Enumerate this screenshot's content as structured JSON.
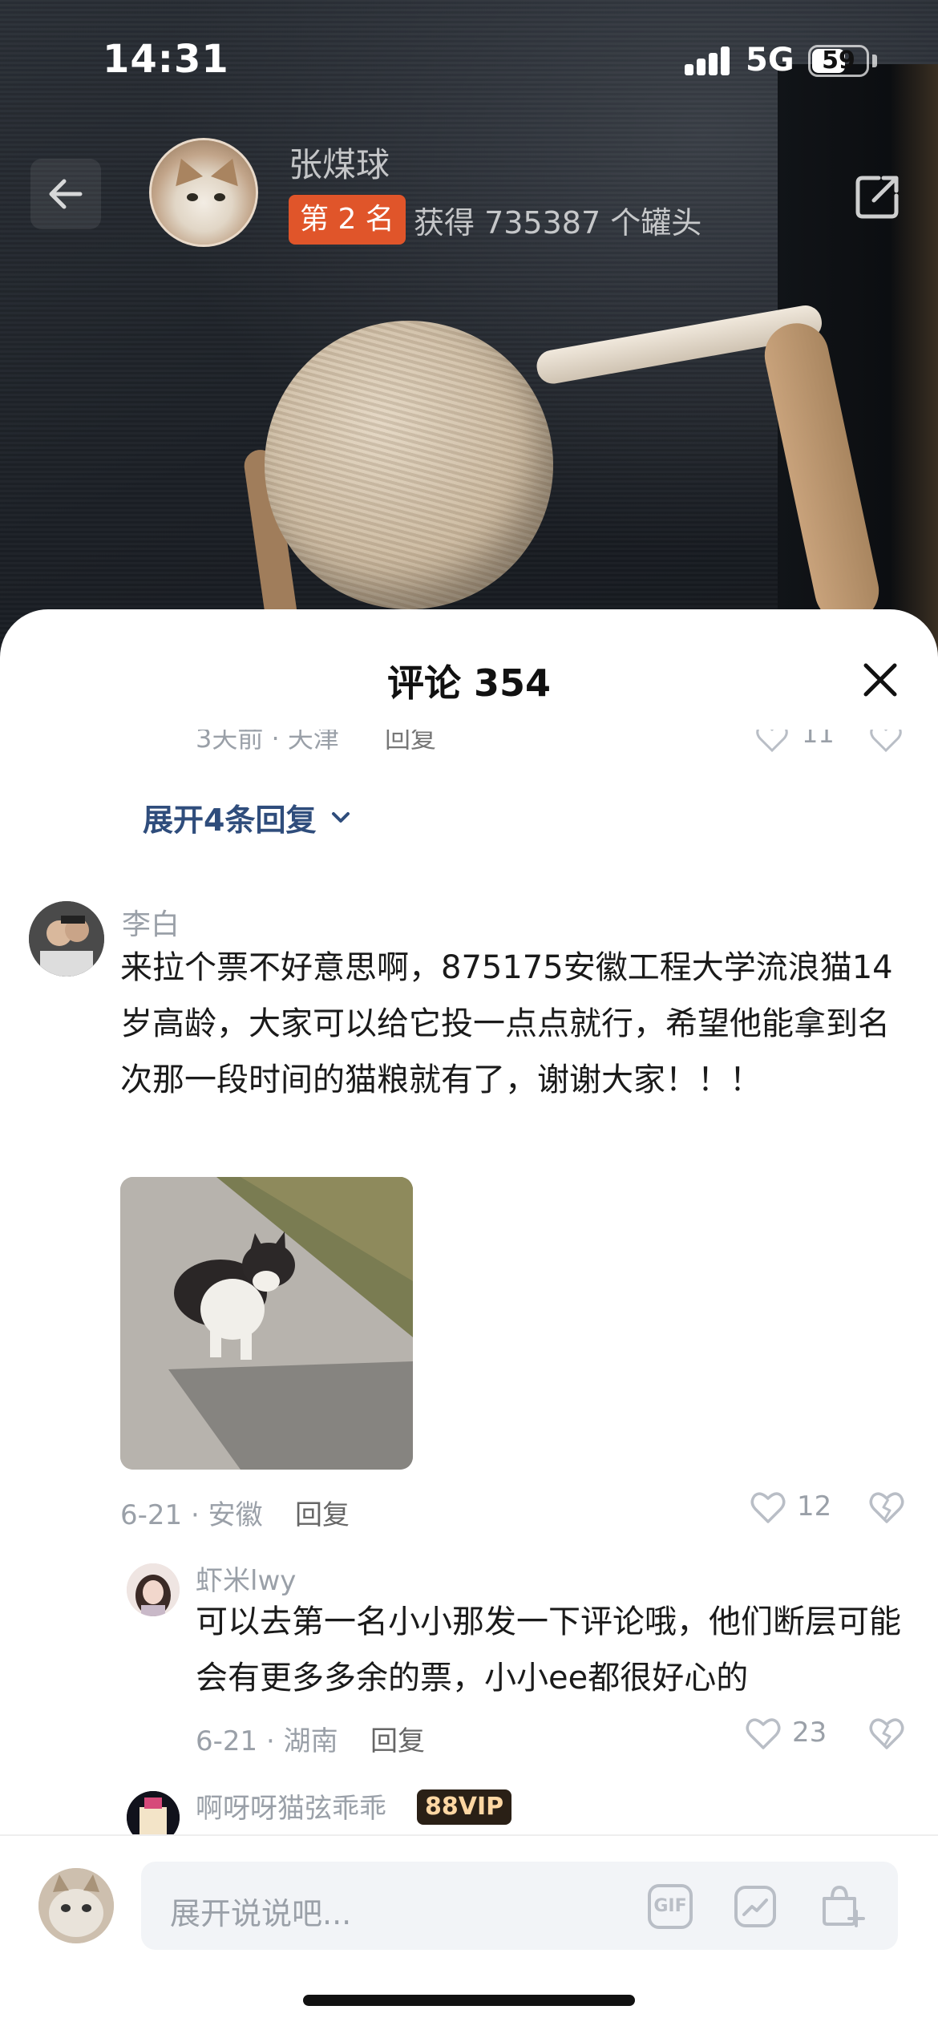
{
  "status_bar": {
    "time": "14:31",
    "network": "5G",
    "battery": "59",
    "battery_level_percent": 59
  },
  "profile": {
    "name": "张煤球",
    "rank": "第 2 名",
    "tins": "获得 735387 个罐头"
  },
  "sheet": {
    "title": "评论 354",
    "faded_row": {
      "meta": "3天前 · 天津",
      "reply": "回复",
      "likes": "11"
    },
    "expand_replies": "展开4条回复"
  },
  "comment": {
    "author": "李白",
    "text": "来拉个票不好意思啊，875175安徽工程大学流浪猫14岁高龄，大家可以给它投一点点就行，希望他能拿到名次那一段时间的猫粮就有了，谢谢大家！！！",
    "meta": "6-21 · 安徽",
    "reply_label": "回复",
    "likes": "12"
  },
  "reply_1": {
    "author": "虾米lwy",
    "text": "可以去第一名小小那发一下评论哦，他们断层可能会有更多多余的票，小小ee都很好心的",
    "meta": "6-21 · 湖南",
    "reply_label": "回复",
    "likes": "23"
  },
  "reply_2": {
    "author": "啊呀呀猫弦乖乖",
    "badge": "88VIP"
  },
  "input_bar": {
    "placeholder": "展开说说吧...",
    "gif_label": "GIF"
  },
  "colors": {
    "rank_badge": "#e0552a",
    "link_blue": "#2f4d7c",
    "muted_gray": "#9aa0a8"
  },
  "icons": [
    "back-arrow-icon",
    "share-icon",
    "close-icon",
    "chevron-down-icon",
    "heart-icon",
    "broken-heart-icon",
    "gif-icon",
    "sticker-icon",
    "gift-add-icon"
  ]
}
